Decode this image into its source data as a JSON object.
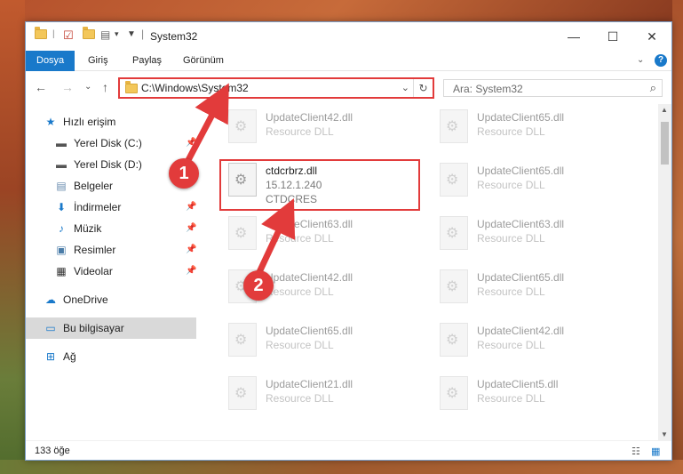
{
  "window": {
    "title": "System32"
  },
  "ribbon": {
    "tabs": [
      "Dosya",
      "Giriş",
      "Paylaş",
      "Görünüm"
    ]
  },
  "address": {
    "path": "C:\\Windows\\System32"
  },
  "search": {
    "placeholder": "Ara: System32"
  },
  "sidebar": {
    "items": [
      {
        "label": "Hızlı erişim",
        "icon": "star-icon"
      },
      {
        "label": "Yerel Disk (C:)",
        "icon": "drive-icon"
      },
      {
        "label": "Yerel Disk (D:)",
        "icon": "drive-icon"
      },
      {
        "label": "Belgeler",
        "icon": "document-icon"
      },
      {
        "label": "İndirmeler",
        "icon": "download-icon"
      },
      {
        "label": "Müzik",
        "icon": "music-icon"
      },
      {
        "label": "Resimler",
        "icon": "picture-icon"
      },
      {
        "label": "Videolar",
        "icon": "video-icon"
      },
      {
        "label": "OneDrive",
        "icon": "cloud-icon"
      },
      {
        "label": "Bu bilgisayar",
        "icon": "computer-icon"
      },
      {
        "label": "Ağ",
        "icon": "network-icon"
      }
    ]
  },
  "files": [
    {
      "name": "UpdateClient42.dll",
      "desc": "Resource DLL",
      "sub": ""
    },
    {
      "name": "UpdateClient65.dll",
      "desc": "Resource DLL",
      "sub": ""
    },
    {
      "name": "ctdcrbrz.dll",
      "desc": "15.12.1.240",
      "sub": "CTDCRES"
    },
    {
      "name": "UpdateClient65.dll",
      "desc": "Resource DLL",
      "sub": ""
    },
    {
      "name": "UpdateClient63.dll",
      "desc": "Resource DLL",
      "sub": ""
    },
    {
      "name": "UpdateClient63.dll",
      "desc": "Resource DLL",
      "sub": ""
    },
    {
      "name": "UpdateClient42.dll",
      "desc": "Resource DLL",
      "sub": ""
    },
    {
      "name": "UpdateClient65.dll",
      "desc": "Resource DLL",
      "sub": ""
    },
    {
      "name": "UpdateClient65.dll",
      "desc": "Resource DLL",
      "sub": ""
    },
    {
      "name": "UpdateClient42.dll",
      "desc": "Resource DLL",
      "sub": ""
    },
    {
      "name": "UpdateClient21.dll",
      "desc": "Resource DLL",
      "sub": ""
    },
    {
      "name": "UpdateClient5.dll",
      "desc": "Resource DLL",
      "sub": ""
    }
  ],
  "status": {
    "count": "133 öğe"
  },
  "annotations": {
    "step1": "1",
    "step2": "2"
  },
  "colors": {
    "accent": "#1979ca",
    "highlight": "#e23b3b"
  }
}
